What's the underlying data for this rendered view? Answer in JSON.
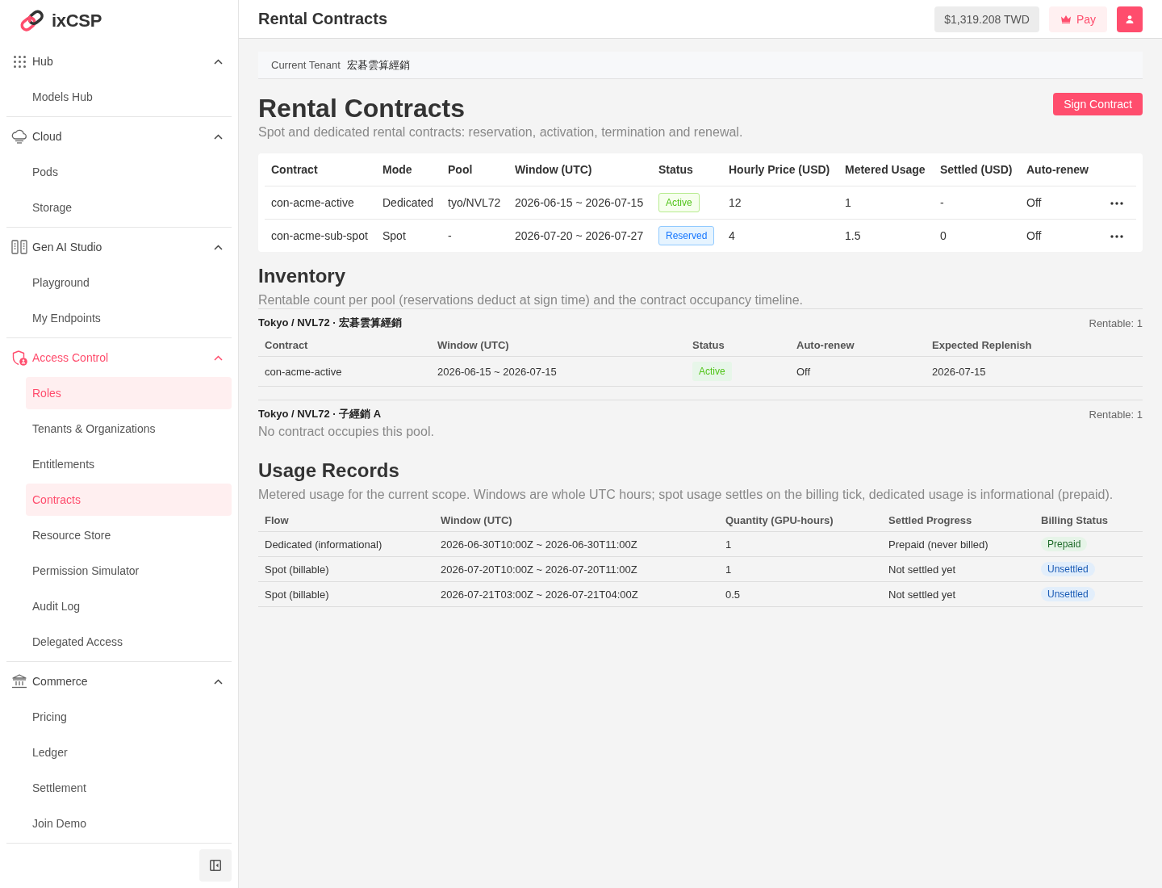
{
  "brand": {
    "name": "ixCSP"
  },
  "sidebar": {
    "groups": [
      {
        "label": "Hub",
        "expanded": true,
        "items": [
          {
            "label": "Models Hub",
            "selected": false
          }
        ]
      },
      {
        "label": "Cloud",
        "expanded": true,
        "items": [
          {
            "label": "Pods",
            "selected": false
          },
          {
            "label": "Storage",
            "selected": false
          }
        ]
      },
      {
        "label": "Gen AI Studio",
        "expanded": true,
        "items": [
          {
            "label": "Playground",
            "selected": false
          },
          {
            "label": "My Endpoints",
            "selected": false
          }
        ]
      },
      {
        "label": "Access Control",
        "expanded": true,
        "items": [
          {
            "label": "Roles",
            "selected": true
          },
          {
            "label": "Tenants & Organizations",
            "selected": false
          },
          {
            "label": "Entitlements",
            "selected": false
          },
          {
            "label": "Contracts",
            "selected": true
          },
          {
            "label": "Resource Store",
            "selected": false
          },
          {
            "label": "Permission Simulator",
            "selected": false
          },
          {
            "label": "Audit Log",
            "selected": false
          },
          {
            "label": "Delegated Access",
            "selected": false
          }
        ]
      },
      {
        "label": "Commerce",
        "expanded": true,
        "items": [
          {
            "label": "Pricing",
            "selected": false
          },
          {
            "label": "Ledger",
            "selected": false
          },
          {
            "label": "Settlement",
            "selected": false
          },
          {
            "label": "Join Demo",
            "selected": false
          }
        ]
      }
    ]
  },
  "header": {
    "title": "Rental Contracts",
    "balance": "$1,319.208 TWD",
    "pay_button": "Pay"
  },
  "tenant_bar": {
    "label": "Current Tenant",
    "value": "宏碁雲算經銷"
  },
  "page": {
    "title": "Rental Contracts",
    "subtitle": "Spot and dedicated rental contracts: reservation, activation, termination and renewal.",
    "primary_button": "Sign Contract"
  },
  "contracts_table": {
    "columns": [
      "Contract",
      "Mode",
      "Pool",
      "Window (UTC)",
      "Status",
      "Hourly Price (USD)",
      "Metered Usage",
      "Settled (USD)",
      "Auto-renew"
    ],
    "rows": [
      {
        "contract": "con-acme-active",
        "mode": "Dedicated",
        "pool": "tyo/NVL72",
        "window": "2026-06-15 ~ 2026-07-15",
        "status": {
          "label": "Active",
          "kind": "active"
        },
        "hourly_price": "12",
        "metered_usage": "1",
        "settled": "-",
        "auto_renew": "Off"
      },
      {
        "contract": "con-acme-sub-spot",
        "mode": "Spot",
        "pool": "-",
        "window": "2026-07-20 ~ 2026-07-27",
        "status": {
          "label": "Reserved",
          "kind": "reserved"
        },
        "hourly_price": "4",
        "metered_usage": "1.5",
        "settled": "0",
        "auto_renew": "Off"
      }
    ]
  },
  "inventory": {
    "title": "Inventory",
    "subtitle": "Rentable count per pool (reservations deduct at sign time) and the contract occupancy timeline.",
    "pools": [
      {
        "name": "Tokyo / NVL72 · 宏碁雲算經銷",
        "rentable": "Rentable: 1",
        "columns": [
          "Contract",
          "Window (UTC)",
          "Status",
          "Auto-renew",
          "Expected Replenish"
        ],
        "rows": [
          {
            "contract": "con-acme-active",
            "window": "2026-06-15 ~ 2026-07-15",
            "status": {
              "label": "Active",
              "kind": "active"
            },
            "auto_renew": "Off",
            "expected_replenish": "2026-07-15"
          }
        ]
      },
      {
        "name": "Tokyo / NVL72 · 子經銷 A",
        "rentable": "Rentable: 1",
        "empty_text": "No contract occupies this pool."
      }
    ]
  },
  "usage_records": {
    "title": "Usage Records",
    "subtitle": "Metered usage for the current scope. Windows are whole UTC hours; spot usage settles on the billing tick, dedicated usage is informational (prepaid).",
    "columns": [
      "Flow",
      "Window (UTC)",
      "Quantity (GPU-hours)",
      "Settled Progress",
      "Billing Status"
    ],
    "rows": [
      {
        "flow": "Dedicated (informational)",
        "window": "2026-06-30T10:00Z ~ 2026-06-30T11:00Z",
        "quantity": "1",
        "settled_progress": "Prepaid (never billed)",
        "billing_status": {
          "label": "Prepaid",
          "kind": "prepaid"
        }
      },
      {
        "flow": "Spot (billable)",
        "window": "2026-07-20T10:00Z ~ 2026-07-20T11:00Z",
        "quantity": "1",
        "settled_progress": "Not settled yet",
        "billing_status": {
          "label": "Unsettled",
          "kind": "unsettled"
        }
      },
      {
        "flow": "Spot (billable)",
        "window": "2026-07-21T03:00Z ~ 2026-07-21T04:00Z",
        "quantity": "0.5",
        "settled_progress": "Not settled yet",
        "billing_status": {
          "label": "Unsettled",
          "kind": "unsettled"
        }
      }
    ]
  }
}
